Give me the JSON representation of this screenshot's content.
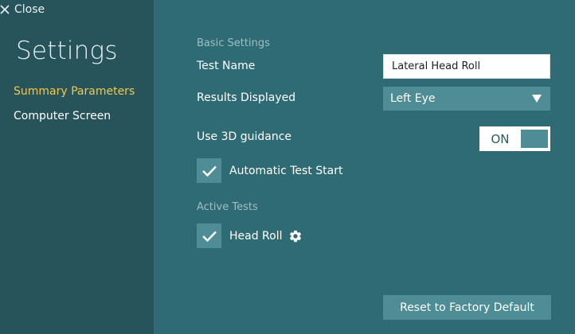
{
  "header": {
    "close_label": "Close"
  },
  "sidebar": {
    "title": "Settings",
    "items": [
      {
        "label": "Summary Parameters",
        "active": true
      },
      {
        "label": "Computer Screen",
        "active": false
      }
    ]
  },
  "basic_settings": {
    "section_label": "Basic Settings",
    "test_name": {
      "label": "Test Name",
      "value": "Lateral Head Roll"
    },
    "results_displayed": {
      "label": "Results Displayed",
      "selected": "Left Eye"
    },
    "use_3d_guidance": {
      "label": "Use 3D guidance",
      "state": "ON"
    },
    "automatic_test_start": {
      "label": "Automatic Test Start",
      "checked": true
    }
  },
  "active_tests": {
    "section_label": "Active Tests",
    "items": [
      {
        "label": "Head Roll",
        "checked": true
      }
    ]
  },
  "footer": {
    "reset_label": "Reset to Factory Default"
  },
  "colors": {
    "sidebar_bg": "#27535b",
    "main_bg": "#2f6b74",
    "control_bg": "#4e8d96",
    "accent": "#f2c94c"
  }
}
